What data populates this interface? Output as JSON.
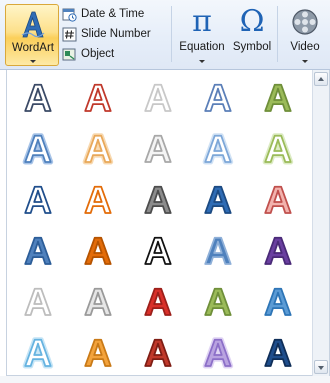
{
  "ribbon": {
    "wordart_label": "WordArt",
    "date_time_label": "Date & Time",
    "slide_number_label": "Slide Number",
    "object_label": "Object",
    "equation_label": "Equation",
    "symbol_label": "Symbol",
    "video_label": "Video",
    "equation_glyph": "π",
    "symbol_glyph": "Ω"
  },
  "gallery": {
    "glyph": "A",
    "rows": [
      [
        {
          "icon": "wordart-style-1-1",
          "fill": "#ffffff",
          "stroke": "#3b4a66",
          "glow": ""
        },
        {
          "icon": "wordart-style-1-2",
          "fill": "#ffffff",
          "stroke": "#c0392b",
          "glow": ""
        },
        {
          "icon": "wordart-style-1-3",
          "fill": "#ffffff",
          "stroke": "#c8c8c8",
          "glow": ""
        },
        {
          "icon": "wordart-style-1-4",
          "fill": "#ffffff",
          "stroke": "#5b7fb8",
          "glow": ""
        },
        {
          "icon": "wordart-style-1-5",
          "fill": "#9bbb59",
          "stroke": "#6f8f3a",
          "glow": ""
        }
      ],
      [
        {
          "icon": "wordart-style-2-1",
          "fill": "#ffffff",
          "stroke": "#4f81bd",
          "glow": "#a8c4e8"
        },
        {
          "icon": "wordart-style-2-2",
          "fill": "#ffffff",
          "stroke": "#e8a85a",
          "glow": "#f8d9b0"
        },
        {
          "icon": "wordart-style-2-3",
          "fill": "#f4f4f4",
          "stroke": "#a8a8a8",
          "glow": ""
        },
        {
          "icon": "wordart-style-2-4",
          "fill": "#ffffff",
          "stroke": "#7da7d8",
          "glow": "#d1e2f5"
        },
        {
          "icon": "wordart-style-2-5",
          "fill": "#ffffff",
          "stroke": "#9bbb59",
          "glow": "#dcebc3"
        }
      ],
      [
        {
          "icon": "wordart-style-3-1",
          "fill": "#ffffff",
          "stroke": "#1f4e8c",
          "glow": ""
        },
        {
          "icon": "wordart-style-3-2",
          "fill": "#ffffff",
          "stroke": "#e36c09",
          "glow": ""
        },
        {
          "icon": "wordart-style-3-3",
          "fill": "#8c8c8c",
          "stroke": "#4d4d4d",
          "glow": ""
        },
        {
          "icon": "wordart-style-3-4",
          "fill": "#2f6cb5",
          "stroke": "#1c4a82",
          "glow": ""
        },
        {
          "icon": "wordart-style-3-5",
          "fill": "#f2b2ad",
          "stroke": "#c0504d",
          "glow": ""
        }
      ],
      [
        {
          "icon": "wordart-style-4-1",
          "fill": "#4f81bd",
          "stroke": "#2c5d98",
          "glow": ""
        },
        {
          "icon": "wordart-style-4-2",
          "fill": "#e36c09",
          "stroke": "#b55300",
          "glow": ""
        },
        {
          "icon": "wordart-style-4-3",
          "fill": "#ffffff",
          "stroke": "#111111",
          "glow": ""
        },
        {
          "icon": "wordart-style-4-4",
          "fill": "#4f81bd",
          "stroke": "#8fb0d8",
          "glow": ""
        },
        {
          "icon": "wordart-style-4-5",
          "fill": "#6a3fa0",
          "stroke": "#4a2a78",
          "glow": ""
        }
      ],
      [
        {
          "icon": "wordart-style-5-1",
          "fill": "#ffffff",
          "stroke": "#bdbdbd",
          "glow": ""
        },
        {
          "icon": "wordart-style-5-2",
          "fill": "#e6e6e6",
          "stroke": "#9a9a9a",
          "glow": ""
        },
        {
          "icon": "wordart-style-5-3",
          "fill": "#d9302a",
          "stroke": "#9c1f1a",
          "glow": ""
        },
        {
          "icon": "wordart-style-5-4",
          "fill": "#9bbb59",
          "stroke": "#6f8f3a",
          "glow": ""
        },
        {
          "icon": "wordart-style-5-5",
          "fill": "#5b9bd5",
          "stroke": "#2e75b6",
          "glow": ""
        }
      ],
      [
        {
          "icon": "wordart-style-6-1",
          "fill": "#ffffff",
          "stroke": "#66b3e0",
          "glow": "#c6e5f6"
        },
        {
          "icon": "wordart-style-6-2",
          "fill": "#f3a33c",
          "stroke": "#c97a17",
          "glow": ""
        },
        {
          "icon": "wordart-style-6-3",
          "fill": "#c0392b",
          "stroke": "#7f1d14",
          "glow": ""
        },
        {
          "icon": "wordart-style-6-4",
          "fill": "#b9a3e0",
          "stroke": "#8c6fc8",
          "glow": "#e0d4f4"
        },
        {
          "icon": "wordart-style-6-5",
          "fill": "#1f4e8c",
          "stroke": "#0f2e58",
          "glow": ""
        }
      ]
    ]
  }
}
